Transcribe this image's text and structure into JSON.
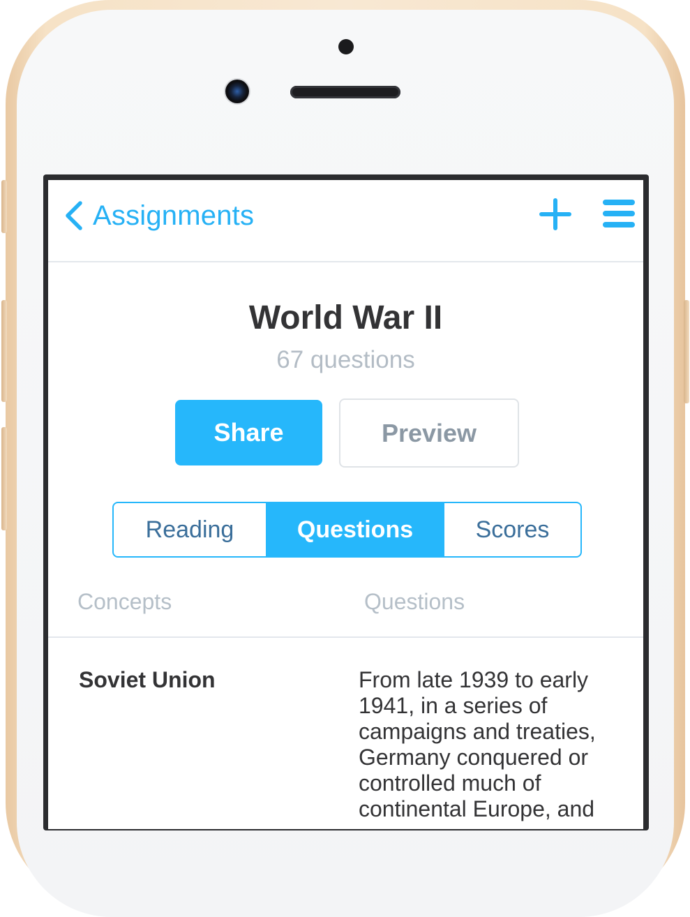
{
  "nav": {
    "back_label": "Assignments"
  },
  "assignment": {
    "title": "World War II",
    "subtitle": "67 questions"
  },
  "actions": {
    "share_label": "Share",
    "preview_label": "Preview"
  },
  "tabs": [
    {
      "label": "Reading",
      "active": false
    },
    {
      "label": "Questions",
      "active": true
    },
    {
      "label": "Scores",
      "active": false
    }
  ],
  "table": {
    "headers": [
      "Concepts",
      "Questions"
    ],
    "rows": [
      {
        "concept": "Soviet Union",
        "question": "From late 1939 to early 1941, in a series of campaigns and treaties, Germany conquered or controlled much of continental Europe, and"
      }
    ]
  },
  "colors": {
    "accent": "#26b7fb",
    "text": "#333335",
    "muted": "#b5bfc8"
  },
  "icons": {
    "back": "chevron-left-icon",
    "add": "plus-icon",
    "menu": "hamburger-menu-icon"
  }
}
